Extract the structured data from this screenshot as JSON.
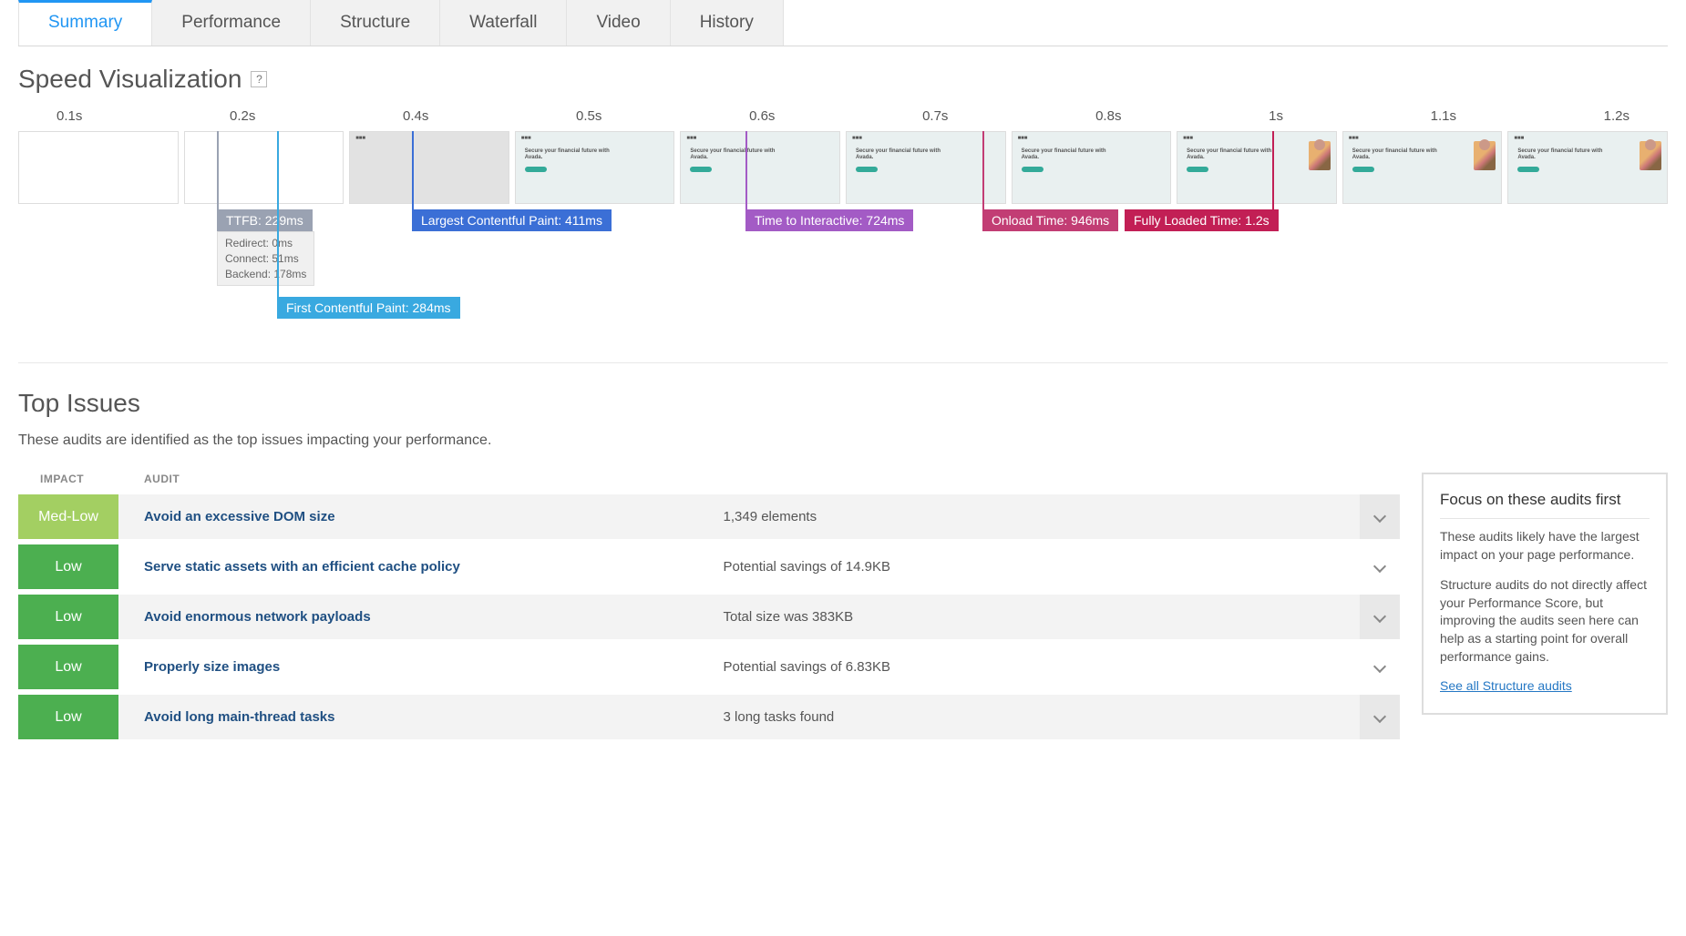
{
  "tabs": [
    "Summary",
    "Performance",
    "Structure",
    "Waterfall",
    "Video",
    "History"
  ],
  "active_tab": 0,
  "speed_viz": {
    "title": "Speed Visualization",
    "help_glyph": "?",
    "ticks": [
      "0.1s",
      "0.2s",
      "0.4s",
      "0.5s",
      "0.6s",
      "0.7s",
      "0.8s",
      "1s",
      "1.1s",
      "1.2s"
    ],
    "frame_headline": "Secure your financial future with Avada.",
    "markers": {
      "ttfb": {
        "label": "TTFB: 229ms",
        "color": "#9aa2b2",
        "details": [
          "Redirect: 0ms",
          "Connect: 51ms",
          "Backend: 178ms"
        ]
      },
      "fcp": {
        "label": "First Contentful Paint: 284ms",
        "color": "#39a9e0"
      },
      "lcp": {
        "label": "Largest Contentful Paint: 411ms",
        "color": "#3b6fd6"
      },
      "tti": {
        "label": "Time to Interactive: 724ms",
        "color": "#a35bc5"
      },
      "onload": {
        "label": "Onload Time: 946ms",
        "color": "#c23d74"
      },
      "fully": {
        "label": "Fully Loaded Time: 1.2s",
        "color": "#c21f55"
      }
    }
  },
  "top_issues": {
    "title": "Top Issues",
    "subtitle": "These audits are identified as the top issues impacting your performance.",
    "headers": {
      "impact": "IMPACT",
      "audit": "AUDIT"
    },
    "rows": [
      {
        "impact": "Med-Low",
        "impact_class": "medlow",
        "audit": "Avoid an excessive DOM size",
        "detail": "1,349 elements"
      },
      {
        "impact": "Low",
        "impact_class": "low",
        "audit": "Serve static assets with an efficient cache policy",
        "detail": "Potential savings of 14.9KB"
      },
      {
        "impact": "Low",
        "impact_class": "low",
        "audit": "Avoid enormous network payloads",
        "detail": "Total size was 383KB"
      },
      {
        "impact": "Low",
        "impact_class": "low",
        "audit": "Properly size images",
        "detail": "Potential savings of 6.83KB"
      },
      {
        "impact": "Low",
        "impact_class": "low",
        "audit": "Avoid long main-thread tasks",
        "detail": "3 long tasks found"
      }
    ]
  },
  "focus_card": {
    "title": "Focus on these audits first",
    "p1": "These audits likely have the largest impact on your page performance.",
    "p2": "Structure audits do not directly affect your Performance Score, but improving the audits seen here can help as a starting point for overall performance gains.",
    "link": "See all Structure audits"
  },
  "chart_data": {
    "type": "timeline",
    "unit": "ms",
    "xlim": [
      0,
      1200
    ],
    "ticks_ms": [
      100,
      200,
      400,
      500,
      600,
      700,
      800,
      1000,
      1100,
      1200
    ],
    "events": [
      {
        "name": "TTFB",
        "t": 229,
        "breakdown": {
          "Redirect": 0,
          "Connect": 51,
          "Backend": 178
        }
      },
      {
        "name": "First Contentful Paint",
        "t": 284
      },
      {
        "name": "Largest Contentful Paint",
        "t": 411
      },
      {
        "name": "Time to Interactive",
        "t": 724
      },
      {
        "name": "Onload Time",
        "t": 946
      },
      {
        "name": "Fully Loaded Time",
        "t": 1200
      }
    ]
  }
}
